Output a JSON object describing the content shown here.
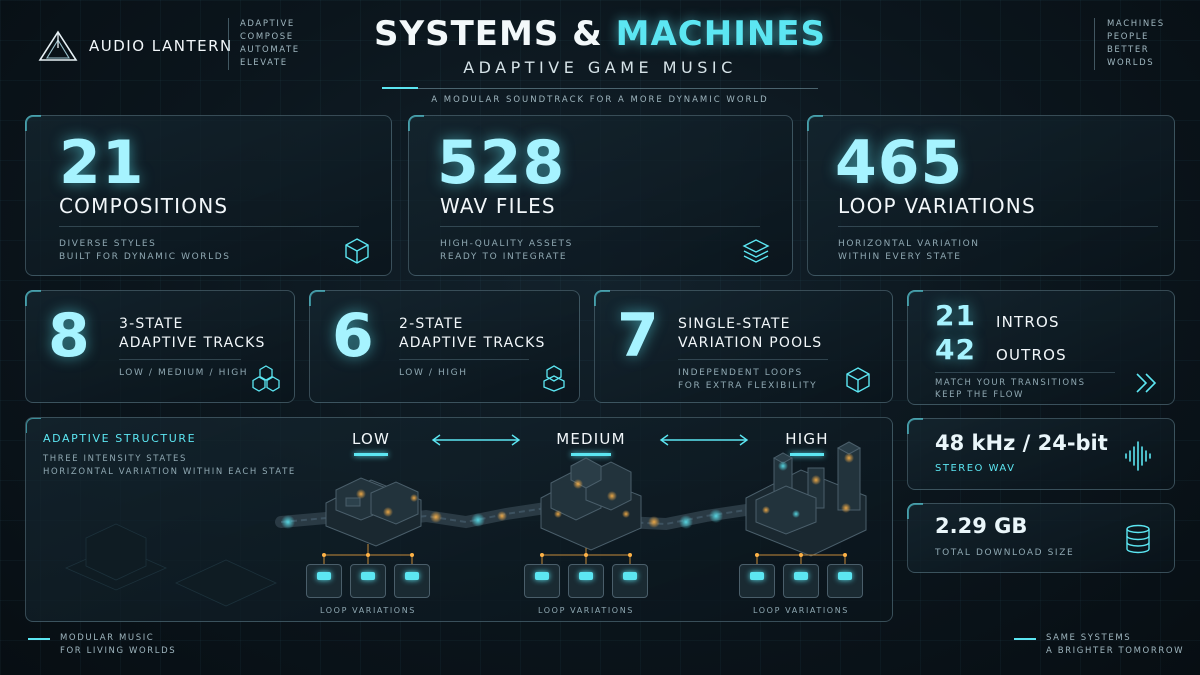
{
  "brand": {
    "name": "AUDIO LANTERN",
    "tagline": [
      "ADAPTIVE",
      "COMPOSE",
      "AUTOMATE",
      "ELEVATE"
    ]
  },
  "top_right_words": [
    "MACHINES",
    "PEOPLE",
    "BETTER",
    "WORLDS"
  ],
  "header": {
    "title_part1": "SYSTEMS &",
    "title_part2": "MACHINES",
    "subtitle": "ADAPTIVE GAME MUSIC",
    "tagline": "A MODULAR SOUNDTRACK FOR A MORE DYNAMIC WORLD"
  },
  "stats_top": [
    {
      "number": "21",
      "label": "COMPOSITIONS",
      "desc1": "DIVERSE STYLES",
      "desc2": "BUILT FOR DYNAMIC WORLDS",
      "icon": "cube-icon"
    },
    {
      "number": "528",
      "label": "WAV FILES",
      "desc1": "HIGH-QUALITY ASSETS",
      "desc2": "READY TO INTEGRATE",
      "icon": "layers-icon"
    },
    {
      "number": "465",
      "label": "LOOP VARIATIONS",
      "desc1": "HORIZONTAL VARIATION",
      "desc2": "WITHIN EVERY STATE",
      "icon": "none"
    }
  ],
  "stats_mid": [
    {
      "number": "8",
      "label1": "3-STATE",
      "label2": "ADAPTIVE TRACKS",
      "desc1": "LOW / MEDIUM / HIGH",
      "desc2": "",
      "icon": "cube-cluster-icon"
    },
    {
      "number": "6",
      "label1": "2-STATE",
      "label2": "ADAPTIVE TRACKS",
      "desc1": "LOW / HIGH",
      "desc2": "",
      "icon": "cube-stack-icon"
    },
    {
      "number": "7",
      "label1": "SINGLE-STATE",
      "label2": "VARIATION POOLS",
      "desc1": "INDEPENDENT LOOPS",
      "desc2": "FOR EXTRA FLEXIBILITY",
      "icon": "cube-icon"
    }
  ],
  "intros_outros": {
    "intros_num": "21",
    "intros_label": "INTROS",
    "outros_num": "42",
    "outros_label": "OUTROS",
    "desc1": "MATCH YOUR TRANSITIONS",
    "desc2": "KEEP THE FLOW",
    "icon": "double-chevron-right-icon"
  },
  "format": {
    "value": "48 kHz / 24-bit",
    "desc": "STEREO WAV",
    "icon": "waveform-icon"
  },
  "size": {
    "value": "2.29 GB",
    "desc": "TOTAL DOWNLOAD SIZE",
    "icon": "database-icon"
  },
  "structure": {
    "title": "ADAPTIVE STRUCTURE",
    "desc1": "THREE INTENSITY STATES",
    "desc2": "HORIZONTAL VARIATION WITHIN EACH STATE",
    "states": [
      "LOW",
      "MEDIUM",
      "HIGH"
    ],
    "loop_label": "LOOP VARIATIONS"
  },
  "footer": {
    "left1": "MODULAR MUSIC",
    "left2": "FOR LIVING WORLDS",
    "right1": "SAME SYSTEMS",
    "right2": "A BRIGHTER TOMORROW"
  },
  "colors": {
    "accent": "#5ce6f2",
    "number": "#a6f3ff",
    "background": "#0b151c"
  }
}
